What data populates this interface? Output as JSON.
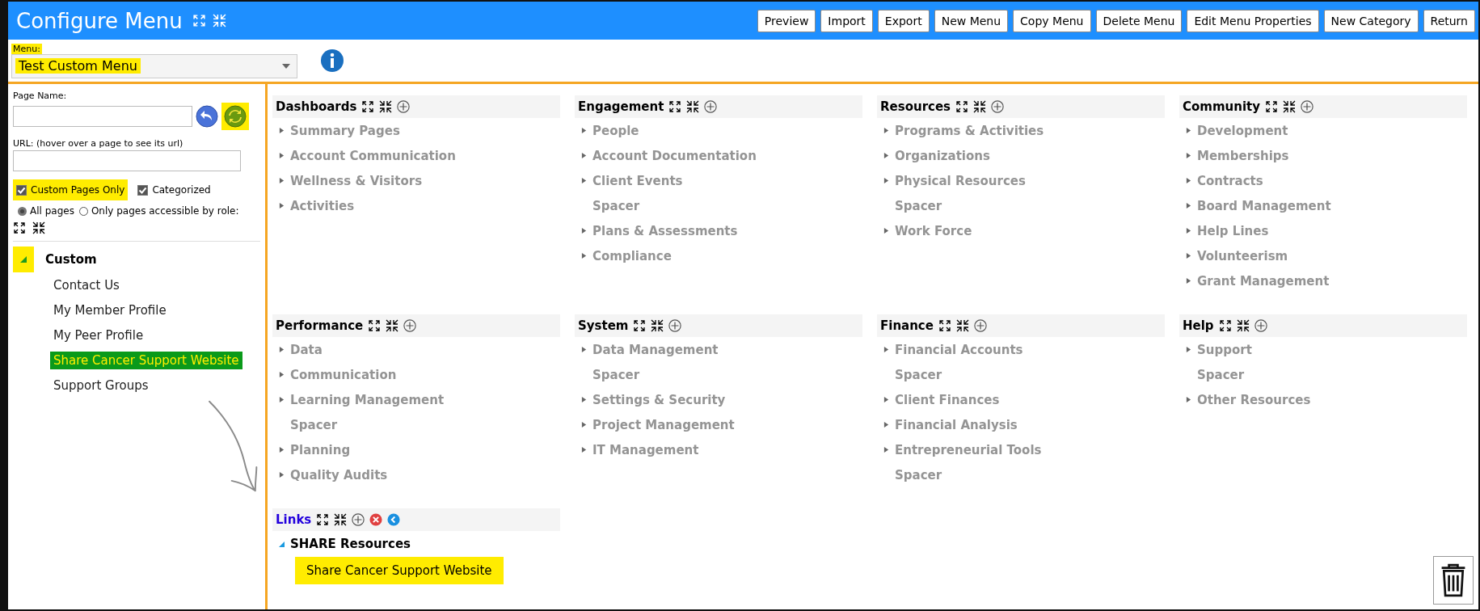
{
  "header": {
    "title": "Configure Menu",
    "buttons": [
      "Preview",
      "Import",
      "Export",
      "New Menu",
      "Copy Menu",
      "Delete Menu",
      "Edit Menu Properties",
      "New Category",
      "Return"
    ]
  },
  "menu_select": {
    "label": "Menu:",
    "value": "Test Custom Menu",
    "highlighted": true
  },
  "page_name": {
    "label": "Page Name:",
    "refresh_highlighted": true
  },
  "url": {
    "label": "URL: (hover over a page to see its url)"
  },
  "filters": [
    {
      "label": "Custom Pages Only",
      "checked": true,
      "highlighted": true
    },
    {
      "label": "Categorized",
      "checked": true,
      "highlighted": false
    }
  ],
  "scope": [
    {
      "label": "All pages",
      "selected": true
    },
    {
      "label": "Only pages accessible by role:",
      "selected": false
    }
  ],
  "page_tree": [
    {
      "label": "Custom",
      "expanded": true,
      "highlighted": true,
      "children": [
        {
          "label": "Contact Us",
          "selected": false
        },
        {
          "label": "My Member Profile",
          "selected": false
        },
        {
          "label": "My Peer Profile",
          "selected": false
        },
        {
          "label": "Share Cancer Support Website",
          "selected": true
        },
        {
          "label": "Support Groups",
          "selected": false
        }
      ]
    }
  ],
  "categories": [
    {
      "title": "Dashboards",
      "selected": false,
      "items": [
        {
          "label": "Summary Pages",
          "kind": "folder",
          "expanded": false
        },
        {
          "label": "Account Communication",
          "kind": "folder",
          "expanded": false
        },
        {
          "label": "Wellness & Visitors",
          "kind": "folder",
          "expanded": false
        },
        {
          "label": "Activities",
          "kind": "folder",
          "expanded": false
        }
      ]
    },
    {
      "title": "Engagement",
      "selected": false,
      "items": [
        {
          "label": "People",
          "kind": "folder",
          "expanded": false
        },
        {
          "label": "Account Documentation",
          "kind": "folder",
          "expanded": false
        },
        {
          "label": "Client Events",
          "kind": "folder",
          "expanded": false
        },
        {
          "label": "Spacer",
          "kind": "spacer"
        },
        {
          "label": "Plans & Assessments",
          "kind": "folder",
          "expanded": false
        },
        {
          "label": "Compliance",
          "kind": "folder",
          "expanded": false
        }
      ]
    },
    {
      "title": "Resources",
      "selected": false,
      "items": [
        {
          "label": "Programs & Activities",
          "kind": "folder",
          "expanded": false
        },
        {
          "label": "Organizations",
          "kind": "folder",
          "expanded": false
        },
        {
          "label": "Physical Resources",
          "kind": "folder",
          "expanded": false
        },
        {
          "label": "Spacer",
          "kind": "spacer"
        },
        {
          "label": "Work Force",
          "kind": "folder",
          "expanded": false
        }
      ]
    },
    {
      "title": "Community",
      "selected": false,
      "items": [
        {
          "label": "Development",
          "kind": "folder",
          "expanded": false
        },
        {
          "label": "Memberships",
          "kind": "folder",
          "expanded": false
        },
        {
          "label": "Contracts",
          "kind": "folder",
          "expanded": false
        },
        {
          "label": "Board Management",
          "kind": "folder",
          "expanded": false
        },
        {
          "label": "Help Lines",
          "kind": "folder",
          "expanded": false
        },
        {
          "label": "Volunteerism",
          "kind": "folder",
          "expanded": false
        },
        {
          "label": "Grant Management",
          "kind": "folder",
          "expanded": false
        }
      ]
    },
    {
      "title": "Performance",
      "selected": false,
      "items": [
        {
          "label": "Data",
          "kind": "folder",
          "expanded": false
        },
        {
          "label": "Communication",
          "kind": "folder",
          "expanded": false
        },
        {
          "label": "Learning Management",
          "kind": "folder",
          "expanded": false
        },
        {
          "label": "Spacer",
          "kind": "spacer"
        },
        {
          "label": "Planning",
          "kind": "folder",
          "expanded": false
        },
        {
          "label": "Quality Audits",
          "kind": "folder",
          "expanded": false
        }
      ]
    },
    {
      "title": "System",
      "selected": false,
      "items": [
        {
          "label": "Data Management",
          "kind": "folder",
          "expanded": false
        },
        {
          "label": "Spacer",
          "kind": "spacer"
        },
        {
          "label": "Settings & Security",
          "kind": "folder",
          "expanded": false
        },
        {
          "label": "Project Management",
          "kind": "folder",
          "expanded": false
        },
        {
          "label": "IT Management",
          "kind": "folder",
          "expanded": false
        }
      ]
    },
    {
      "title": "Finance",
      "selected": false,
      "items": [
        {
          "label": "Financial Accounts",
          "kind": "folder",
          "expanded": false
        },
        {
          "label": "Spacer",
          "kind": "spacer"
        },
        {
          "label": "Client Finances",
          "kind": "folder",
          "expanded": false
        },
        {
          "label": "Financial Analysis",
          "kind": "folder",
          "expanded": false
        },
        {
          "label": "Entrepreneurial Tools",
          "kind": "folder",
          "expanded": false
        },
        {
          "label": "Spacer",
          "kind": "spacer"
        }
      ]
    },
    {
      "title": "Help",
      "selected": false,
      "items": [
        {
          "label": "Support",
          "kind": "folder",
          "expanded": false
        },
        {
          "label": "Spacer",
          "kind": "spacer"
        },
        {
          "label": "Other Resources",
          "kind": "folder",
          "expanded": false
        }
      ]
    },
    {
      "title": "Links",
      "selected": true,
      "items": [
        {
          "label": "SHARE Resources",
          "kind": "folder",
          "expanded": true,
          "children": [
            {
              "label": "Share Cancer Support Website",
              "highlighted": true
            }
          ]
        }
      ]
    }
  ]
}
